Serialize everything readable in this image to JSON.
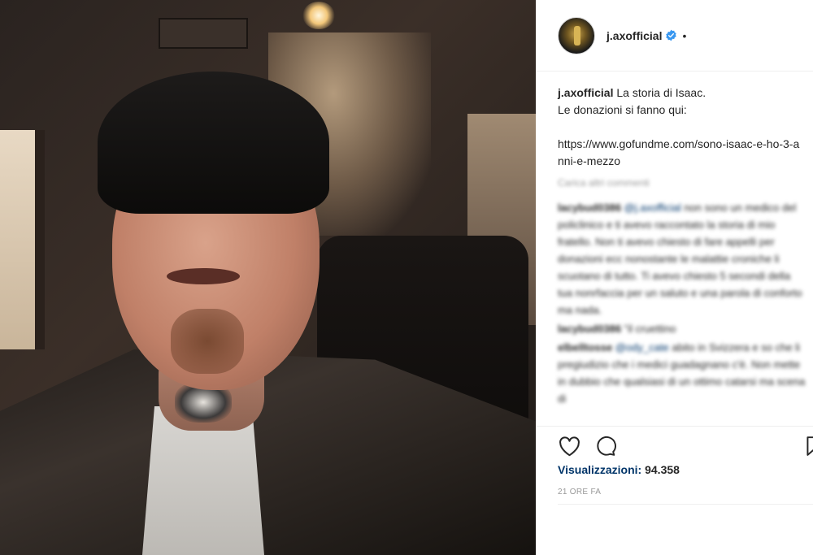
{
  "post": {
    "author": "j.axofficial",
    "verified": true,
    "separator": "•",
    "caption_user": "j.axofficial",
    "caption_line1": " La storia di Isaac.",
    "caption_line2": "Le donazioni si fanno qui:",
    "caption_link": "https://www.gofundme.com/sono-isaac-e-ho-3-anni-e-mezzo",
    "load_more": "Carica altri commenti",
    "comments": [
      {
        "user": "lacybud0386",
        "mention": "@j.axofficial",
        "text": " non sono un medico del policlinico e ti avevo raccontato la storia di mio fratello. Non ti avevo chiesto di fare appelli per donazioni ecc nonostante le malattie croniche li scuotano di tutto. Ti avevo chiesto 5 secondi della tua nonrfaccia per un saluto e una parola di conforto ma nada."
      },
      {
        "user": "lacybud0386",
        "mention": "",
        "text": " \"il cruettino"
      },
      {
        "user": "elbelltosse",
        "mention": "@ody_cate",
        "text": " abito in Svizzera e so che li pregiudizio che i medici guadagnano c'è. Non mette in dubbio che qualsiasi di un ottimo catarsi ma scena di"
      }
    ],
    "views_label": "Visualizzazioni:",
    "views_count": "94.358",
    "time_ago": "21 ORE FA"
  },
  "icons": [
    "like-icon",
    "comment-icon",
    "save-icon",
    "verified-badge-icon"
  ],
  "colors": {
    "verified": "#3897f0",
    "text": "#262626",
    "muted": "#999999",
    "link": "#003569",
    "border": "#efefef"
  }
}
